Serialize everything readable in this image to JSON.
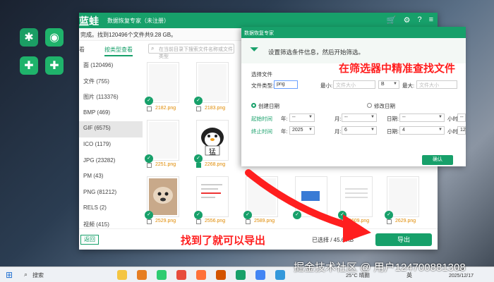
{
  "app": {
    "logo": "蓝蛙",
    "title": "数据恢复专家（未注册）",
    "info_text": "完成。找到120496个文件共9.28 GB。",
    "tab_left": "看",
    "tab_right": "按类型查看",
    "search_placeholder": "在当前目录下搜索文件名称或文件类型",
    "sidebar": [
      {
        "label": "面 (120496)"
      },
      {
        "label": "文件 (755)"
      },
      {
        "label": "图片 (113376)"
      },
      {
        "label": "BMP (469)"
      },
      {
        "label": "GIF (6575)"
      },
      {
        "label": "ICO (1179)"
      },
      {
        "label": "JPG (23282)"
      },
      {
        "label": "PM (43)"
      },
      {
        "label": "PNG (81212)"
      },
      {
        "label": "RELS (2)"
      },
      {
        "label": "视频 (415)"
      }
    ],
    "files": [
      {
        "name": "2182.png"
      },
      {
        "name": "2183.png"
      },
      {
        "name": "2251.png"
      },
      {
        "name": "2268.png"
      },
      {
        "name": "2529.png"
      },
      {
        "name": "2556.png"
      },
      {
        "name": "2589.png"
      },
      {
        "name": "2609.png"
      },
      {
        "name": "2629.png"
      }
    ],
    "penguin_text": "猛",
    "back_label": "返回",
    "selected_info": "已选择 / 45.6 KB",
    "export_label": "导出"
  },
  "dialog": {
    "title": "数据恢复专家",
    "message": "设置筛选条件信息，然后开始筛选。",
    "section": "选择文件",
    "file_type_label": "文件类型:",
    "file_type_value": "png",
    "min_label": "最小:",
    "min_placeholder": "文件大小",
    "unit_b": "B",
    "max_label": "最大:",
    "max_placeholder": "文件大小",
    "create_date_label": "创建日期",
    "modify_date_label": "修改日期",
    "start_time_label": "起始时间",
    "end_time_label": "终止时间",
    "year_label": "年:",
    "month_label": "月:",
    "day_label": "日期:",
    "hour_label": "小时:",
    "empty_value": "--",
    "end_year": "2025",
    "end_month": "6",
    "end_day": "4",
    "end_hour": "12",
    "confirm_label": "确认"
  },
  "annotations": {
    "top": "在筛选器中精准查找文件",
    "bottom": "找到了就可以导出"
  },
  "taskbar": {
    "search_label": "搜索",
    "weather": "25°C 晴朗",
    "lang": "英",
    "date": "2025/12/17",
    "time": "1:34"
  },
  "watermark": "掘金技术社区 @ 用户124700881308"
}
